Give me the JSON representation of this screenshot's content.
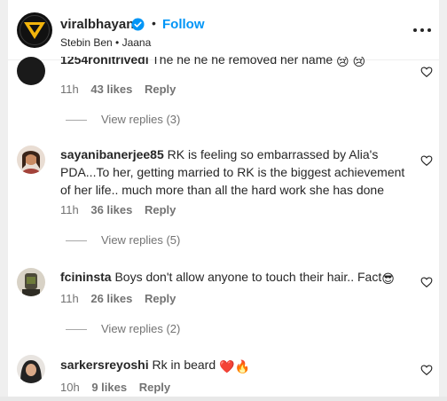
{
  "header": {
    "username": "viralbhayani",
    "separator": "•",
    "follow_label": "Follow",
    "subtitle": "Stebin Ben • Jaana"
  },
  "comments": [
    {
      "username": "1254ronitrivedi",
      "text": "The he he he removed her name",
      "emoji": "😢 😢",
      "time": "11h",
      "likes": "43 likes",
      "reply_label": "Reply",
      "view_replies": "View replies (3)"
    },
    {
      "username": "sayanibanerjee85",
      "text_line1": "RK is feeling so embarrassed by Alia's",
      "text_line2": "PDA...To her, getting married to RK is the biggest achievement",
      "text_line3": "of her life.. much more than all the hard work she has done",
      "time": "11h",
      "likes": "36 likes",
      "reply_label": "Reply",
      "view_replies": "View replies (5)"
    },
    {
      "username": "fcininsta",
      "text": "Boys don't allow anyone to touch their hair.. Fact",
      "emoji": "😎",
      "time": "11h",
      "likes": "26 likes",
      "reply_label": "Reply",
      "view_replies": "View replies (2)"
    },
    {
      "username": "sarkersreyoshi",
      "text": "Rk in beard",
      "emoji": "❤️🔥",
      "time": "10h",
      "likes": "9 likes",
      "reply_label": "Reply"
    }
  ],
  "colors": {
    "accent": "#0095f6",
    "text": "#262626",
    "muted": "#737373"
  },
  "icons": [
    "verified-badge-icon",
    "more-options-icon",
    "heart-outline-icon"
  ]
}
